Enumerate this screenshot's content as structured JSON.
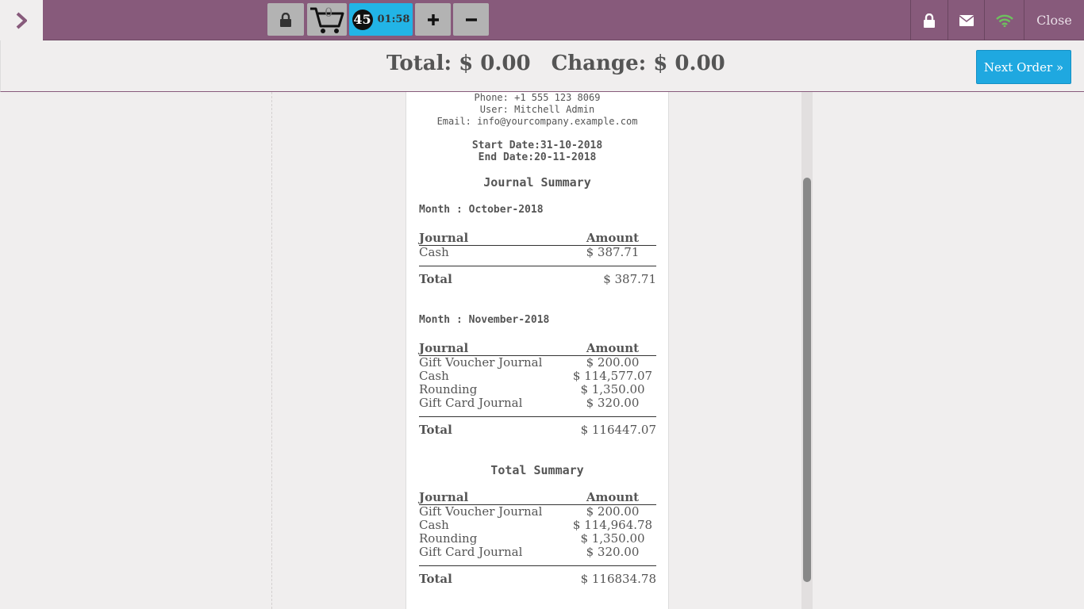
{
  "topbar": {
    "cart_count": "0",
    "timer_badge": "45",
    "timer_time": "01:58",
    "close_label": "Close",
    "colors": {
      "bar": "#875a7b",
      "timer": "#22b4e6",
      "wifi": "#6ec05f"
    }
  },
  "header": {
    "total_text": "Total: $ 0.00",
    "change_text": "Change: $ 0.00",
    "next_order_label": "Next Order »"
  },
  "receipt": {
    "phone": "Phone: +1 555 123 8069",
    "user": "User: Mitchell Admin",
    "email": "Email: info@yourcompany.example.com",
    "start_date": "Start Date:31-10-2018",
    "end_date": "End Date:20-11-2018",
    "journal_summary_title": "Journal Summary",
    "col_journal": "Journal",
    "col_amount": "Amount",
    "total_label": "Total",
    "months": [
      {
        "label": "Month : October-2018",
        "rows": [
          {
            "journal": "Cash",
            "amount": "$ 387.71"
          }
        ],
        "total": "$ 387.71"
      },
      {
        "label": "Month : November-2018",
        "rows": [
          {
            "journal": "Gift Voucher Journal",
            "amount": "$ 200.00"
          },
          {
            "journal": "Cash",
            "amount": "$ 114,577.07"
          },
          {
            "journal": "Rounding",
            "amount": "$ 1,350.00"
          },
          {
            "journal": "Gift Card Journal",
            "amount": "$ 320.00"
          }
        ],
        "total": "$ 116447.07"
      }
    ],
    "total_summary_title": "Total Summary",
    "summary": {
      "rows": [
        {
          "journal": "Gift Voucher Journal",
          "amount": "$ 200.00"
        },
        {
          "journal": "Cash",
          "amount": "$ 114,964.78"
        },
        {
          "journal": "Rounding",
          "amount": "$ 1,350.00"
        },
        {
          "journal": "Gift Card Journal",
          "amount": "$ 320.00"
        }
      ],
      "total": "$ 116834.78"
    }
  }
}
